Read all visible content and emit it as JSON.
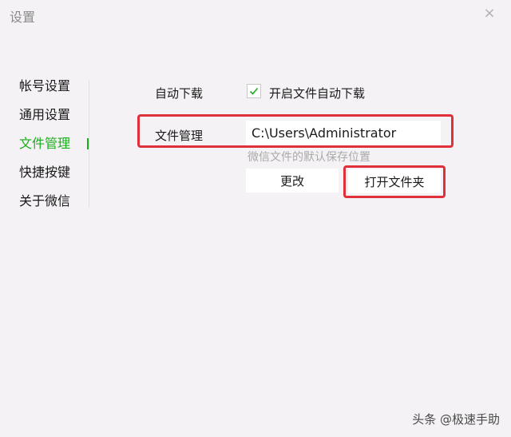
{
  "window": {
    "title": "设置",
    "close_label": "×"
  },
  "sidebar": {
    "items": [
      {
        "label": "帐号设置"
      },
      {
        "label": "通用设置"
      },
      {
        "label": "文件管理"
      },
      {
        "label": "快捷按键"
      },
      {
        "label": "关于微信"
      }
    ],
    "active_index": 2
  },
  "settings": {
    "auto_download": {
      "label": "自动下载",
      "checkbox_label": "开启文件自动下载",
      "checked": true
    },
    "file_management": {
      "label": "文件管理",
      "path_value": "C:\\Users\\Administrator",
      "hint": "微信文件的默认保存位置",
      "change_button": "更改",
      "open_folder_button": "打开文件夹"
    }
  },
  "colors": {
    "accent": "#1aad19",
    "highlight": "#e0303a"
  },
  "watermark": "头条 @极速手助"
}
